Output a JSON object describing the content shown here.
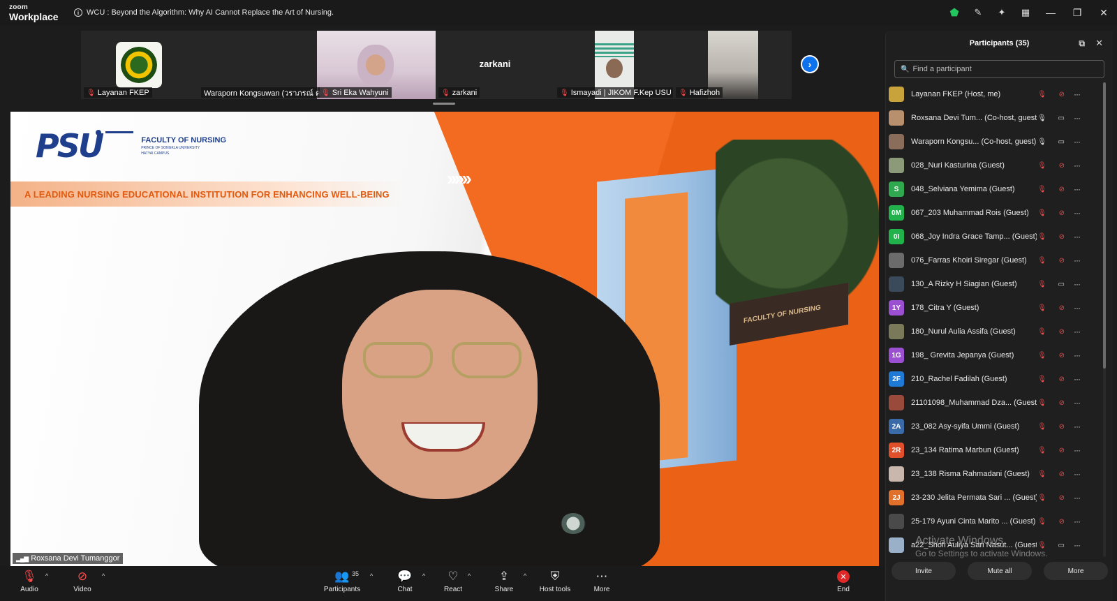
{
  "titlebar": {
    "logo_top": "zoom",
    "logo_bottom": "Workplace",
    "meeting_title": "WCU : Beyond the Algorithm: Why AI Cannot Replace the Art of Nursing."
  },
  "gallery": {
    "tiles": [
      {
        "name": "Layanan FKEP"
      },
      {
        "name": "Waraporn Kongsuwan (วราภรณ์ ค..."
      },
      {
        "name": "Sri Eka Wahyuni"
      },
      {
        "name": "zarkani",
        "center_name": "zarkani"
      },
      {
        "name": "Ismayadi | JIKOM F.Kep USU"
      },
      {
        "name": "Hafizhoh"
      }
    ]
  },
  "main_video": {
    "speaker_name": "Roxsana Devi Tumanggor",
    "slide": {
      "logo_mark": "PSU",
      "faculty": "FACULTY OF NURSING",
      "university": "PRINCE OF SONGKLA UNIVERSITY",
      "campus": "HATYAI CAMPUS",
      "tagline": "A LEADING NURSING EDUCATIONAL INSTITUTION FOR ENHANCING WELL-BEING",
      "chevrons": "››››››",
      "sign_text": "FACULTY OF NURSING"
    }
  },
  "toolbar": {
    "audio": "Audio",
    "video": "Video",
    "participants": "Participants",
    "participants_count": "35",
    "chat": "Chat",
    "react": "React",
    "share": "Share",
    "host_tools": "Host tools",
    "more": "More",
    "end": "End"
  },
  "panel": {
    "title": "Participants (35)",
    "search_placeholder": "Find a participant",
    "participants": [
      {
        "name": "Layanan FKEP (Host, me)",
        "initials": "",
        "color": "#c8a23a",
        "mic": "off",
        "video": "off"
      },
      {
        "name": "Roxsana Devi Tum... (Co-host, guest)",
        "initials": "",
        "color": "#b9906e",
        "mic": "on",
        "video": "on"
      },
      {
        "name": "Waraporn Kongsu... (Co-host, guest)",
        "initials": "",
        "color": "#8a6d5a",
        "mic": "on",
        "video": "on"
      },
      {
        "name": "028_Nuri Kasturina (Guest)",
        "initials": "",
        "color": "#8d9a7a",
        "mic": "off",
        "video": "off"
      },
      {
        "name": "048_Selviana Yemima (Guest)",
        "initials": "S",
        "color": "#2fa84f",
        "mic": "off",
        "video": "off"
      },
      {
        "name": "067_203 Muhammad Rois (Guest)",
        "initials": "0M",
        "color": "#22b24c",
        "mic": "off",
        "video": "off"
      },
      {
        "name": "068_Joy Indra Grace Tamp...  (Guest)",
        "initials": "0I",
        "color": "#22b24c",
        "mic": "off",
        "video": "off"
      },
      {
        "name": "076_Farras Khoiri Siregar (Guest)",
        "initials": "",
        "color": "#6b6b6b",
        "mic": "off",
        "video": "off"
      },
      {
        "name": "130_A Rizky H Siagian (Guest)",
        "initials": "",
        "color": "#3a4a5a",
        "mic": "off",
        "video": "on"
      },
      {
        "name": "178_Citra Y (Guest)",
        "initials": "1Y",
        "color": "#9b4fd1",
        "mic": "off",
        "video": "off"
      },
      {
        "name": "180_Nurul Aulia Assifa (Guest)",
        "initials": "",
        "color": "#7a7a5a",
        "mic": "off",
        "video": "off"
      },
      {
        "name": "198_ Grevita Jepanya (Guest)",
        "initials": "1G",
        "color": "#9b4fd1",
        "mic": "off",
        "video": "off"
      },
      {
        "name": "210_Rachel Fadilah (Guest)",
        "initials": "2F",
        "color": "#1f7ad6",
        "mic": "off",
        "video": "off"
      },
      {
        "name": "21101098_Muhammad Dza...  (Guest)",
        "initials": "",
        "color": "#9a4a3a",
        "mic": "off",
        "video": "off"
      },
      {
        "name": "23_082 Asy-syifa Ummi (Guest)",
        "initials": "2A",
        "color": "#3a6aa8",
        "mic": "off",
        "video": "off"
      },
      {
        "name": "23_134 Ratima Marbun (Guest)",
        "initials": "2R",
        "color": "#e0502a",
        "mic": "off",
        "video": "off"
      },
      {
        "name": "23_138 Risma Rahmadani (Guest)",
        "initials": "",
        "color": "#c9b7ae",
        "mic": "off",
        "video": "off"
      },
      {
        "name": "23-230 Jelita Permata Sari ...  (Guest)",
        "initials": "2J",
        "color": "#e0702a",
        "mic": "off",
        "video": "off"
      },
      {
        "name": "25-179 Ayuni Cinta Marito ...  (Guest)",
        "initials": "",
        "color": "#4a4a4a",
        "mic": "off",
        "video": "off"
      },
      {
        "name": "a22_Shofi Auliya Sari Nasut...  (Guest)",
        "initials": "",
        "color": "#9ab0c8",
        "mic": "off",
        "video": "on"
      }
    ],
    "invite": "Invite",
    "mute_all": "Mute all",
    "more": "More",
    "watermark_line1": "Activate Windows",
    "watermark_line2": "Go to Settings to activate Windows."
  }
}
